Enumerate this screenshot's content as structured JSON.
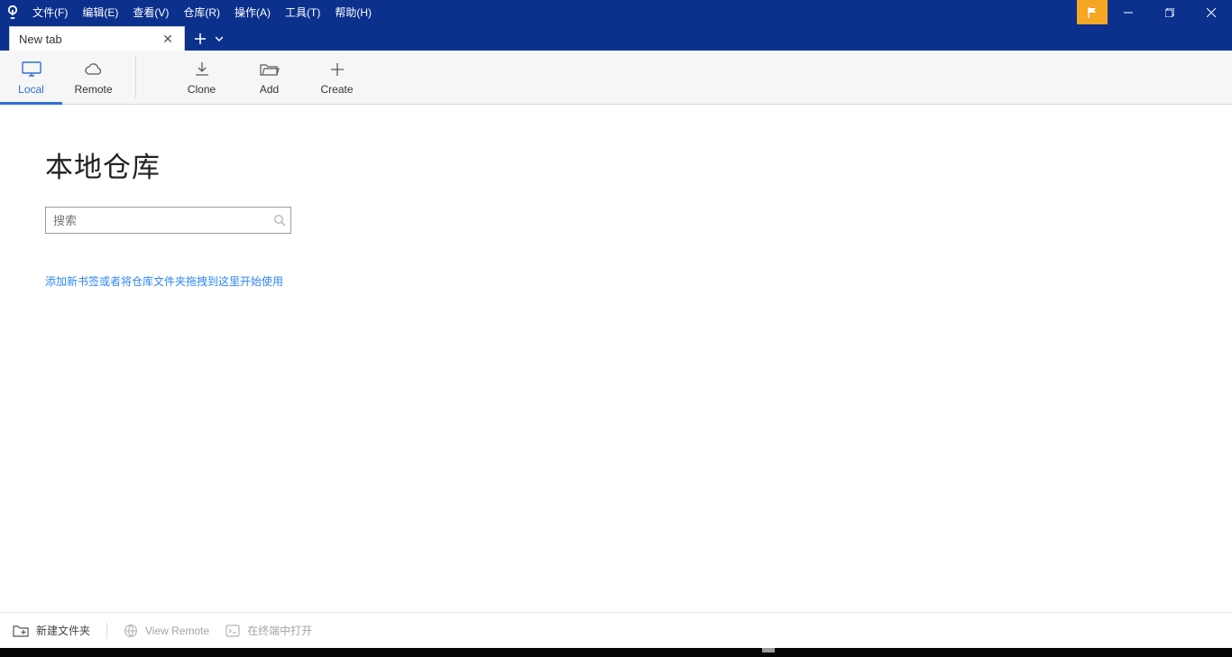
{
  "menu": {
    "file": "文件(F)",
    "edit": "编辑(E)",
    "view": "查看(V)",
    "repo": "仓库(R)",
    "action": "操作(A)",
    "tools": "工具(T)",
    "help": "帮助(H)"
  },
  "tab": {
    "label": "New tab"
  },
  "toolbar": {
    "local": "Local",
    "remote": "Remote",
    "clone": "Clone",
    "add": "Add",
    "create": "Create"
  },
  "main": {
    "title": "本地仓库",
    "search_placeholder": "搜索",
    "hint": "添加新书签或者将仓库文件夹拖拽到这里开始使用"
  },
  "footer": {
    "new_folder": "新建文件夹",
    "view_remote": "View Remote",
    "open_terminal": "在终端中打开"
  }
}
